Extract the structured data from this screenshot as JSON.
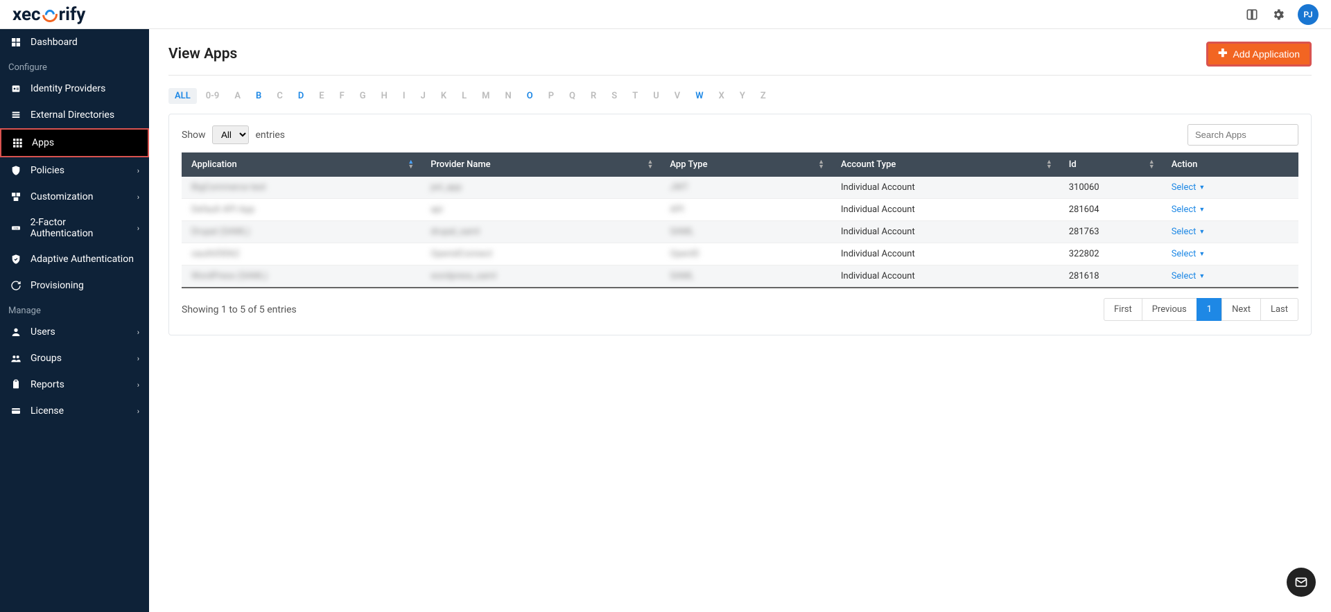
{
  "brand": {
    "name_a": "xec",
    "name_b": "rify",
    "avatar_initials": "PJ"
  },
  "sidebar": {
    "dashboard": "Dashboard",
    "section_configure": "Configure",
    "items_configure": [
      {
        "label": "Identity Providers",
        "expandable": false
      },
      {
        "label": "External Directories",
        "expandable": false
      },
      {
        "label": "Apps",
        "expandable": false,
        "active": true
      },
      {
        "label": "Policies",
        "expandable": true
      },
      {
        "label": "Customization",
        "expandable": true
      },
      {
        "label": "2-Factor Authentication",
        "expandable": true
      },
      {
        "label": "Adaptive Authentication",
        "expandable": false
      },
      {
        "label": "Provisioning",
        "expandable": false
      }
    ],
    "section_manage": "Manage",
    "items_manage": [
      {
        "label": "Users",
        "expandable": true
      },
      {
        "label": "Groups",
        "expandable": true
      },
      {
        "label": "Reports",
        "expandable": true
      },
      {
        "label": "License",
        "expandable": true
      }
    ]
  },
  "page": {
    "title": "View Apps",
    "add_button": "Add Application"
  },
  "alpha_filter": {
    "all": "ALL",
    "items": [
      "0-9",
      "A",
      "B",
      "C",
      "D",
      "E",
      "F",
      "G",
      "H",
      "I",
      "J",
      "K",
      "L",
      "M",
      "N",
      "O",
      "P",
      "Q",
      "R",
      "S",
      "T",
      "U",
      "V",
      "W",
      "X",
      "Y",
      "Z"
    ],
    "highlighted": [
      "B",
      "D",
      "O",
      "W"
    ]
  },
  "table": {
    "show_label_pre": "Show",
    "show_label_post": "entries",
    "show_value": "All",
    "search_placeholder": "Search Apps",
    "columns": [
      "Application",
      "Provider Name",
      "App Type",
      "Account Type",
      "Id",
      "Action"
    ],
    "rows": [
      {
        "app": "BigCommerce test",
        "provider": "jwt_app",
        "type": "JWT",
        "account": "Individual Account",
        "id": "310060",
        "action": "Select"
      },
      {
        "app": "Default API App",
        "provider": "api",
        "type": "API",
        "account": "Individual Account",
        "id": "281604",
        "action": "Select"
      },
      {
        "app": "Drupal (SAML)",
        "provider": "drupal_saml",
        "type": "SAML",
        "account": "Individual Account",
        "id": "281763",
        "action": "Select"
      },
      {
        "app": "oauth05062",
        "provider": "OpenidConnect",
        "type": "OpenID",
        "account": "Individual Account",
        "id": "322802",
        "action": "Select"
      },
      {
        "app": "WordPress (SAML)",
        "provider": "wordpress_saml",
        "type": "SAML",
        "account": "Individual Account",
        "id": "281618",
        "action": "Select"
      }
    ],
    "footer_info": "Showing 1 to 5 of 5 entries",
    "paging": {
      "first": "First",
      "prev": "Previous",
      "current": "1",
      "next": "Next",
      "last": "Last"
    }
  }
}
